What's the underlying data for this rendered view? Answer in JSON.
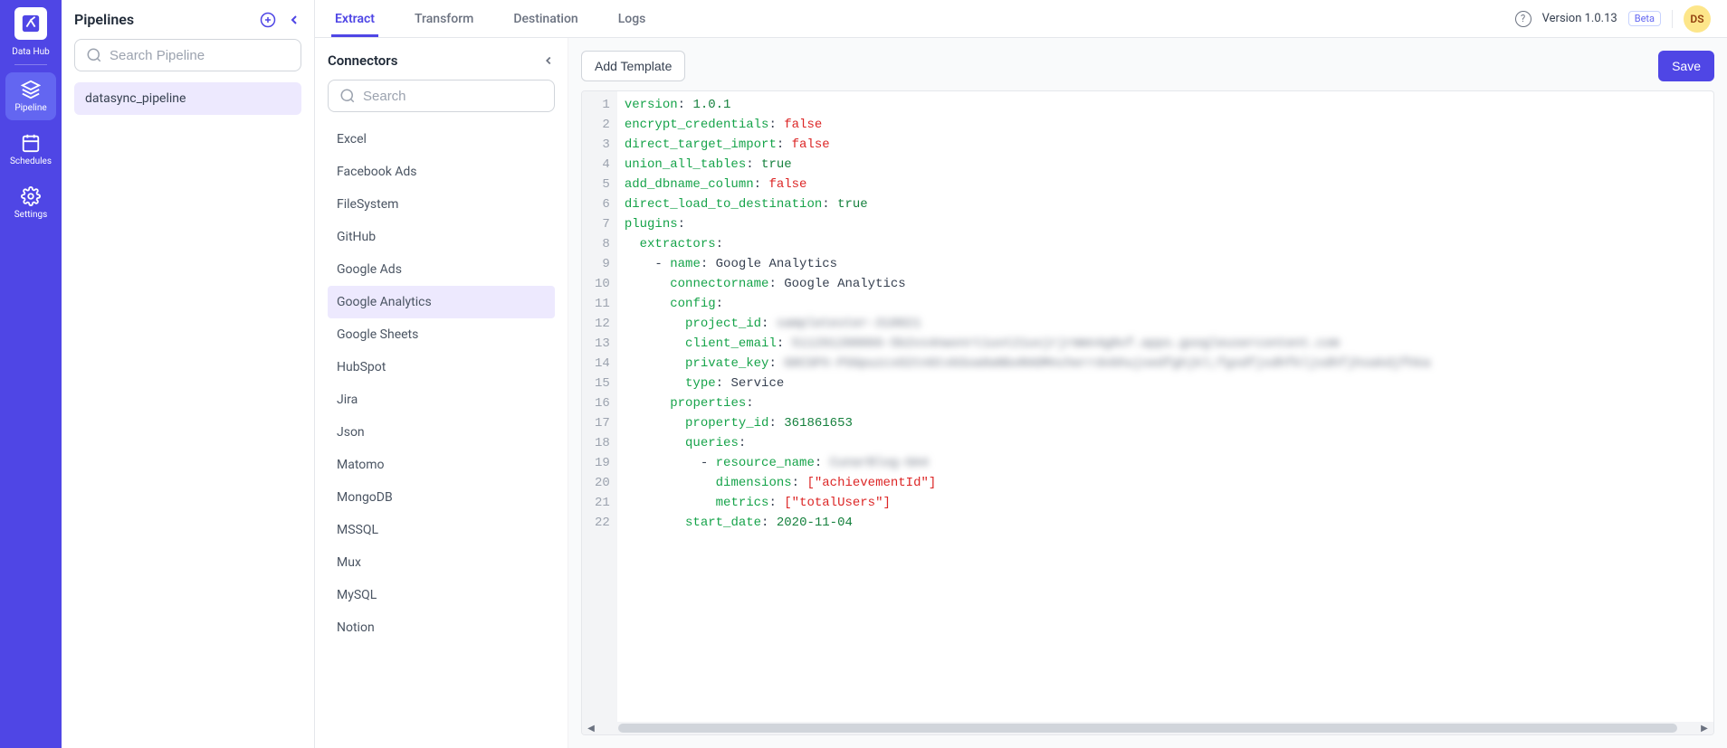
{
  "rail": {
    "logo_label": "Data Hub",
    "items": [
      {
        "id": "pipeline",
        "label": "Pipeline",
        "icon": "layers-icon",
        "active": true
      },
      {
        "id": "schedules",
        "label": "Schedules",
        "icon": "calendar-icon",
        "active": false
      },
      {
        "id": "settings",
        "label": "Settings",
        "icon": "gear-icon",
        "active": false
      }
    ]
  },
  "pipelines": {
    "title": "Pipelines",
    "search_placeholder": "Search Pipeline",
    "items": [
      {
        "name": "datasync_pipeline",
        "selected": true
      }
    ]
  },
  "tabs": [
    {
      "id": "extract",
      "label": "Extract",
      "active": true
    },
    {
      "id": "transform",
      "label": "Transform",
      "active": false
    },
    {
      "id": "destination",
      "label": "Destination",
      "active": false
    },
    {
      "id": "logs",
      "label": "Logs",
      "active": false
    }
  ],
  "top_right": {
    "version": "Version 1.0.13",
    "beta": "Beta",
    "avatar_initials": "DS"
  },
  "connectors": {
    "title": "Connectors",
    "search_placeholder": "Search",
    "items": [
      {
        "name": "Excel"
      },
      {
        "name": "Facebook Ads"
      },
      {
        "name": "FileSystem"
      },
      {
        "name": "GitHub"
      },
      {
        "name": "Google Ads"
      },
      {
        "name": "Google Analytics",
        "selected": true
      },
      {
        "name": "Google Sheets"
      },
      {
        "name": "HubSpot"
      },
      {
        "name": "Jira"
      },
      {
        "name": "Json"
      },
      {
        "name": "Matomo"
      },
      {
        "name": "MongoDB"
      },
      {
        "name": "MSSQL"
      },
      {
        "name": "Mux"
      },
      {
        "name": "MySQL"
      },
      {
        "name": "Notion"
      }
    ]
  },
  "editor": {
    "add_template_label": "Add Template",
    "save_label": "Save",
    "line_count": 22,
    "yaml": {
      "version": "1.0.1",
      "encrypt_credentials": "false",
      "direct_target_import": "false",
      "union_all_tables": "true",
      "add_dbname_column": "false",
      "direct_load_to_destination": "true",
      "extractor_name": "Google Analytics",
      "connectorname": "Google Analytics",
      "project_id": "sampletester-318021",
      "client_email": "511291208066-5b2vs4nwvnrt1uvt21uvjrjrmmn4g0vf.apps.googleusercontent.com",
      "private_key": "G0CSPX-PSGpuzcxO2tnGtvbSoa0aNboRAOMncherrdvbhujsedfghjkl;fgsdfjsdhfkljsdhfjhsakdjfhka",
      "type": "Service",
      "property_id": "361861653",
      "resource_name": "CunarBlog-GA4",
      "dimensions": "[\"achievementId\"]",
      "metrics": "[\"totalUsers\"]",
      "start_date": "2020-11-04"
    }
  }
}
